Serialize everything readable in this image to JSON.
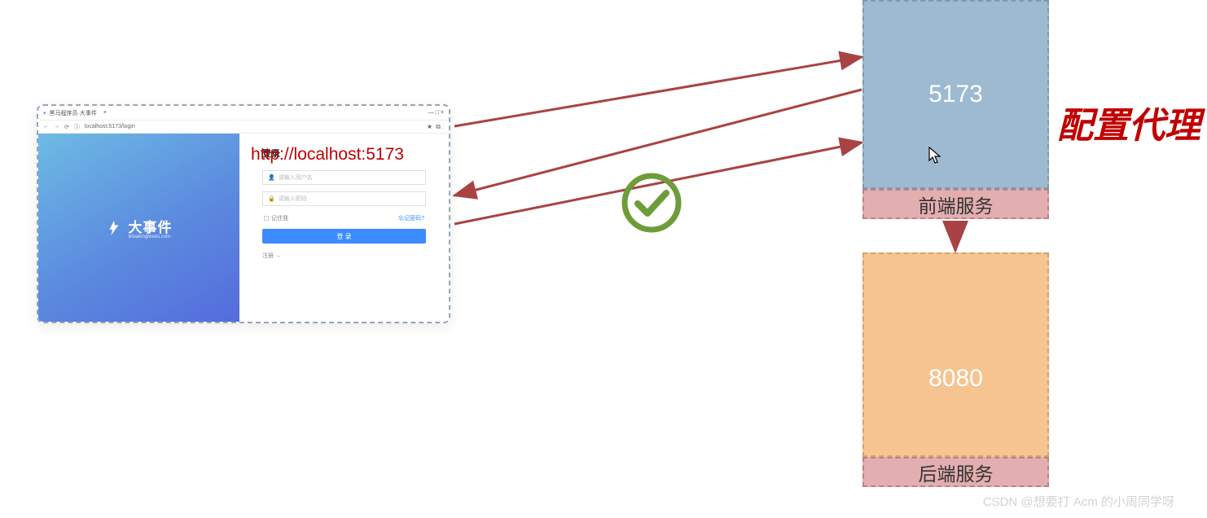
{
  "browser": {
    "tab_title": "黑马程序员·大事件",
    "address": "localhost:5173/login",
    "star_icon": "★",
    "ext_icons": "⧉ ⋮"
  },
  "url_label": "http://localhost:5173",
  "login_form": {
    "brand_name": "大事件",
    "brand_sub": "BreakingNews.com",
    "title": "登录",
    "username_placeholder": "请输入用户名",
    "password_placeholder": "请输入密码",
    "remember_label": "记住我",
    "forgot_label": "忘记密码?",
    "submit_label": "登 录",
    "register_label": "注册 →"
  },
  "frontend": {
    "port": "5173",
    "label": "前端服务"
  },
  "backend": {
    "port": "8080",
    "label": "后端服务"
  },
  "annotation": "配置代理",
  "watermark": "CSDN @想要打 Acm 的小周同学呀",
  "arrows": {
    "color": "#a94343",
    "mid_arrow_color": "#a94343"
  }
}
